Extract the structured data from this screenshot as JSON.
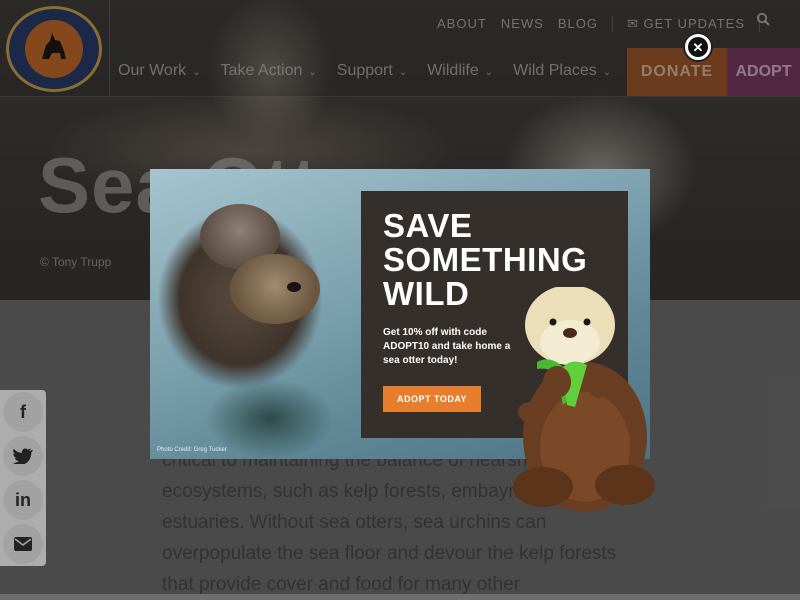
{
  "header": {
    "logo_text": "DEFENDERS OF WILDLIFE",
    "utility_links": [
      "ABOUT",
      "NEWS",
      "BLOG",
      "GET UPDATES"
    ],
    "nav": [
      "Our Work",
      "Take Action",
      "Support",
      "Wildlife",
      "Wild Places"
    ],
    "donate_label": "DONATE",
    "adopt_label": "ADOPT"
  },
  "hero": {
    "title": "Sea Otter",
    "credit": "© Tony Trupp"
  },
  "body": {
    "paragraph": "critical to maintaining the balance of nearshore ecosystems, such as kelp forests, embayments and estuaries. Without sea otters, sea urchins can overpopulate the sea floor and devour the kelp forests that provide cover and food for many other"
  },
  "share": {
    "icons": [
      "facebook-icon",
      "twitter-icon",
      "linkedin-icon",
      "email-icon"
    ]
  },
  "modal": {
    "headline": "SAVE SOMETHING WILD",
    "subtext": "Get 10% off with code ADOPT10 and take home a sea otter today!",
    "button_label": "ADOPT TODAY",
    "photo_credit": "Photo Credit: Greg Tucker",
    "accent_color": "#e67e2e"
  }
}
